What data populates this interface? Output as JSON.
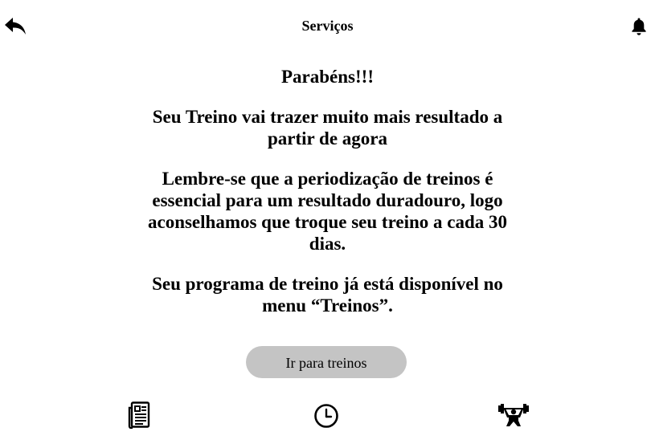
{
  "header": {
    "title": "Serviços",
    "back_icon": "reply-arrow-icon",
    "notification_icon": "bell-icon"
  },
  "messages": {
    "congrats": "Parabéns!!!",
    "result": "Seu Treino vai trazer muito mais resultado a partir de agora",
    "periodization": "Lembre-se que a periodização de treinos é essencial para um resultado duradouro, logo aconselhamos que troque seu treino a cada 30 dias.",
    "program": "Seu programa de treino já está disponível no menu “Treinos”."
  },
  "actions": {
    "go_to_workouts_label": "Ir para treinos"
  },
  "bottom_nav": {
    "items": [
      {
        "id": "news",
        "icon": "newspaper-icon"
      },
      {
        "id": "history",
        "icon": "clock-icon"
      },
      {
        "id": "workouts",
        "icon": "weightlifter-icon"
      }
    ]
  },
  "colors": {
    "button_bg": "#c4c4c4",
    "text": "#000000",
    "background": "#ffffff"
  }
}
